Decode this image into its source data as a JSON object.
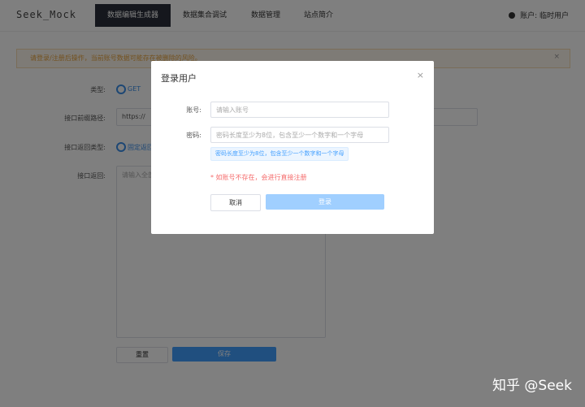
{
  "nav": {
    "logo": "Seek_Mock",
    "tabs": [
      "数据编辑生成器",
      "数据集合调试",
      "数据管理",
      "站点简介"
    ],
    "user": "账户: 临时用户"
  },
  "alert": {
    "message": "请登录/注册后操作，当前账号数据可能存在被删除的风险。",
    "close": "×"
  },
  "form": {
    "type_label": "类型:",
    "type_value": "GET",
    "prefix_label": "接口前缀路径:",
    "prefix_value": "https://",
    "return_type_label": "接口返回类型:",
    "return_type_value": "固定返回",
    "return_label": "接口返回:",
    "return_placeholder": "请输入全部",
    "reset_label": "重置",
    "save_label": "保存"
  },
  "modal": {
    "title": "登录用户",
    "close": "×",
    "account_label": "账号:",
    "account_placeholder": "请输入账号",
    "password_label": "密码:",
    "password_placeholder": "密码长度至少为8位，包含至少一个数字和一个字母",
    "tip": "密码长度至少为8位，包含至少一个数字和一个字母",
    "error": "* 如账号不存在，会进行直接注册",
    "cancel_label": "取消",
    "login_label": "登录"
  },
  "watermark": "知乎 @Seek"
}
